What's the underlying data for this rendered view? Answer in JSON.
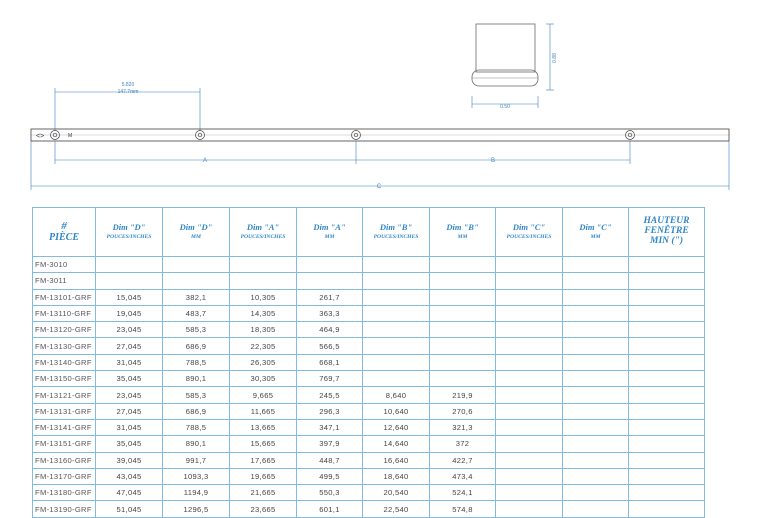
{
  "drawing": {
    "dim_top_value": "5.820",
    "dim_top_mm": "147.7mm",
    "dim_block_width": "0.50",
    "dim_block_height": "0.88",
    "label_a": "A",
    "label_b": "B",
    "label_c": "C",
    "left_mark": "<>",
    "hole_marker": "M"
  },
  "table": {
    "headers": [
      {
        "line1": "#",
        "line2": "PIÈCE"
      },
      {
        "line1": "Dim \"D\"",
        "line2": "POUCES/INCHES"
      },
      {
        "line1": "Dim \"D\"",
        "line2": "MM"
      },
      {
        "line1": "Dim \"A\"",
        "line2": "POUCES/INCHES"
      },
      {
        "line1": "Dim \"A\"",
        "line2": "MM"
      },
      {
        "line1": "Dim \"B\"",
        "line2": "POUCES/INCHES"
      },
      {
        "line1": "Dim \"B\"",
        "line2": "MM"
      },
      {
        "line1": "Dim \"C\"",
        "line2": "POUCES/INCHES"
      },
      {
        "line1": "Dim \"C\"",
        "line2": "MM"
      },
      {
        "line1": "HAUTEUR",
        "line2": "FENÊTRE",
        "line3": "MIN (\")"
      }
    ],
    "rows": [
      [
        "FM-3010",
        "",
        "",
        "",
        "",
        "",
        "",
        "",
        "",
        ""
      ],
      [
        "FM-3011",
        "",
        "",
        "",
        "",
        "",
        "",
        "",
        "",
        ""
      ],
      [
        "FM-13101-GRF",
        "15,045",
        "382,1",
        "10,305",
        "261,7",
        "",
        "",
        "",
        "",
        ""
      ],
      [
        "FM-13110-GRF",
        "19,045",
        "483,7",
        "14,305",
        "363,3",
        "",
        "",
        "",
        "",
        ""
      ],
      [
        "FM-13120-GRF",
        "23,045",
        "585,3",
        "18,305",
        "464,9",
        "",
        "",
        "",
        "",
        ""
      ],
      [
        "FM-13130-GRF",
        "27,045",
        "686,9",
        "22,305",
        "566,5",
        "",
        "",
        "",
        "",
        ""
      ],
      [
        "FM-13140-GRF",
        "31,045",
        "788,5",
        "26,305",
        "668,1",
        "",
        "",
        "",
        "",
        ""
      ],
      [
        "FM-13150-GRF",
        "35,045",
        "890,1",
        "30,305",
        "769,7",
        "",
        "",
        "",
        "",
        ""
      ],
      [
        "FM-13121-GRF",
        "23,045",
        "585,3",
        "9,665",
        "245,5",
        "8,640",
        "219,9",
        "",
        "",
        ""
      ],
      [
        "FM-13131-GRF",
        "27,045",
        "686,9",
        "11,665",
        "296,3",
        "10,640",
        "270,6",
        "",
        "",
        ""
      ],
      [
        "FM-13141-GRF",
        "31,045",
        "788,5",
        "13,665",
        "347,1",
        "12,640",
        "321,3",
        "",
        "",
        ""
      ],
      [
        "FM-13151-GRF",
        "35,045",
        "890,1",
        "15,665",
        "397,9",
        "14,640",
        "372",
        "",
        "",
        ""
      ],
      [
        "FM-13160-GRF",
        "39,045",
        "991,7",
        "17,665",
        "448,7",
        "16,640",
        "422,7",
        "",
        "",
        ""
      ],
      [
        "FM-13170-GRF",
        "43,045",
        "1093,3",
        "19,665",
        "499,5",
        "18,640",
        "473,4",
        "",
        "",
        ""
      ],
      [
        "FM-13180-GRF",
        "47,045",
        "1194,9",
        "21,665",
        "550,3",
        "20,540",
        "524,1",
        "",
        "",
        ""
      ],
      [
        "FM-13190-GRF",
        "51,045",
        "1296,5",
        "23,665",
        "601,1",
        "22,540",
        "574,8",
        "",
        "",
        ""
      ]
    ]
  }
}
